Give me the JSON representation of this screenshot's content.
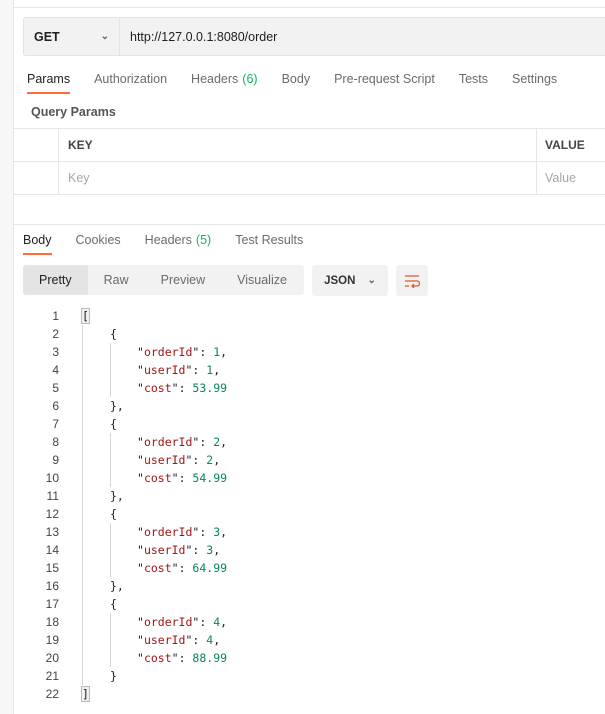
{
  "request": {
    "method": "GET",
    "url": "http://127.0.0.1:8080/order"
  },
  "request_tabs": [
    {
      "label": "Params",
      "active": true
    },
    {
      "label": "Authorization"
    },
    {
      "label": "Headers",
      "count": "(6)"
    },
    {
      "label": "Body"
    },
    {
      "label": "Pre-request Script"
    },
    {
      "label": "Tests"
    },
    {
      "label": "Settings"
    }
  ],
  "query_params": {
    "title": "Query Params",
    "headers": [
      "KEY",
      "VALUE"
    ],
    "placeholders": [
      "Key",
      "Value"
    ]
  },
  "response_tabs": [
    {
      "label": "Body",
      "active": true
    },
    {
      "label": "Cookies"
    },
    {
      "label": "Headers",
      "count": "(5)"
    },
    {
      "label": "Test Results"
    }
  ],
  "view_modes": [
    "Pretty",
    "Raw",
    "Preview",
    "Visualize"
  ],
  "format": "JSON",
  "icons": {
    "wrap": "wrap-lines-icon",
    "chevron": "chevron-down-icon"
  },
  "colors": {
    "accent": "#ff6c37",
    "key": "#a31515",
    "number": "#098658",
    "count": "#0cbb52"
  },
  "code_lines": [
    {
      "i": 0,
      "p": "["
    },
    {
      "i": 1,
      "p": "{"
    },
    {
      "i": 2,
      "k": "orderId",
      "v": "1",
      "p": ","
    },
    {
      "i": 2,
      "k": "userId",
      "v": "1",
      "p": ","
    },
    {
      "i": 2,
      "k": "cost",
      "v": "53.99",
      "p": ""
    },
    {
      "i": 1,
      "p": "},"
    },
    {
      "i": 1,
      "p": "{"
    },
    {
      "i": 2,
      "k": "orderId",
      "v": "2",
      "p": ","
    },
    {
      "i": 2,
      "k": "userId",
      "v": "2",
      "p": ","
    },
    {
      "i": 2,
      "k": "cost",
      "v": "54.99",
      "p": ""
    },
    {
      "i": 1,
      "p": "},"
    },
    {
      "i": 1,
      "p": "{"
    },
    {
      "i": 2,
      "k": "orderId",
      "v": "3",
      "p": ","
    },
    {
      "i": 2,
      "k": "userId",
      "v": "3",
      "p": ","
    },
    {
      "i": 2,
      "k": "cost",
      "v": "64.99",
      "p": ""
    },
    {
      "i": 1,
      "p": "},"
    },
    {
      "i": 1,
      "p": "{"
    },
    {
      "i": 2,
      "k": "orderId",
      "v": "4",
      "p": ","
    },
    {
      "i": 2,
      "k": "userId",
      "v": "4",
      "p": ","
    },
    {
      "i": 2,
      "k": "cost",
      "v": "88.99",
      "p": ""
    },
    {
      "i": 1,
      "p": "}"
    },
    {
      "i": 0,
      "p": "]"
    }
  ]
}
